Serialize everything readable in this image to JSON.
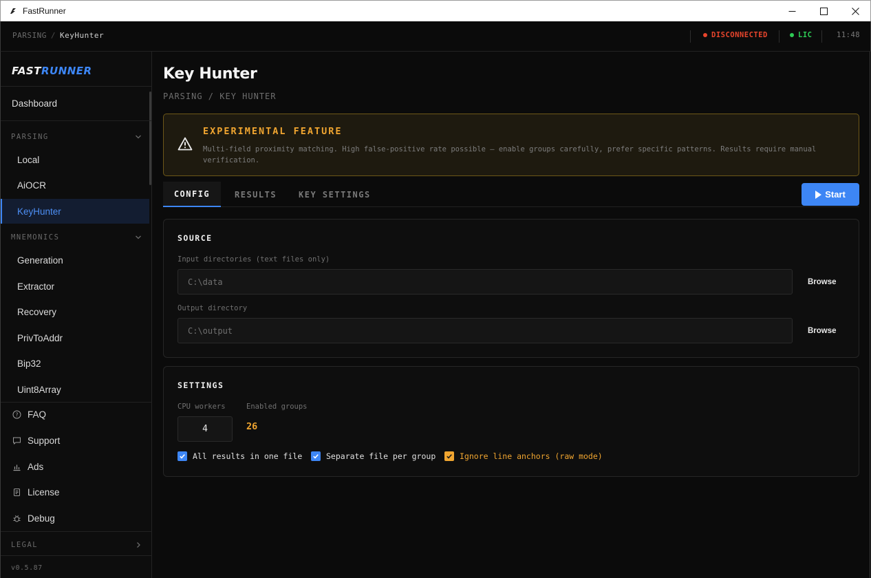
{
  "window": {
    "title": "FastRunner"
  },
  "appbar": {
    "crumb_section": "PARSING",
    "crumb_sep": "/",
    "crumb_page": "KeyHunter",
    "connection_status": "DISCONNECTED",
    "license_status": "LIC",
    "time": "11:48",
    "colors": {
      "disconnected": "#e8452c",
      "lic": "#2ecc55"
    }
  },
  "sidebar": {
    "logo_part1": "FAST",
    "logo_part2": "RUNNER",
    "dashboard": "Dashboard",
    "parsing_header": "PARSING",
    "parsing_items": [
      "Local",
      "AiOCR",
      "KeyHunter"
    ],
    "mnemonics_header": "MNEMONICS",
    "mnemonics_items": [
      "Generation",
      "Extractor",
      "Recovery",
      "PrivToAddr",
      "Bip32",
      "Uint8Array"
    ],
    "utility_items": [
      {
        "label": "FAQ",
        "icon": "help-circle-icon"
      },
      {
        "label": "Support",
        "icon": "chat-icon"
      },
      {
        "label": "Ads",
        "icon": "chart-icon"
      },
      {
        "label": "License",
        "icon": "document-icon"
      },
      {
        "label": "Debug",
        "icon": "bug-icon"
      }
    ],
    "legal_header": "LEGAL",
    "version": "v0.5.87"
  },
  "main": {
    "title": "Key Hunter",
    "breadcrumb": "PARSING / KEY HUNTER",
    "warning": {
      "title": "EXPERIMENTAL FEATURE",
      "text": "Multi-field proximity matching. High false-positive rate possible — enable groups carefully, prefer specific patterns. Results require manual verification."
    },
    "tabs": [
      "CONFIG",
      "RESULTS",
      "KEY SETTINGS"
    ],
    "start_label": "Start",
    "source": {
      "header": "SOURCE",
      "input_label": "Input directories (text files only)",
      "input_placeholder": "C:\\data",
      "output_label": "Output directory",
      "output_placeholder": "C:\\output",
      "browse_label": "Browse"
    },
    "settings": {
      "header": "SETTINGS",
      "cpu_label": "CPU workers",
      "cpu_value": "4",
      "groups_label": "Enabled groups",
      "groups_value": "26",
      "checkboxes": [
        {
          "label": "All results in one file",
          "checked": true
        },
        {
          "label": "Separate file per group",
          "checked": true
        },
        {
          "label": "Ignore line anchors (raw mode)",
          "checked": true
        }
      ]
    }
  },
  "colors": {
    "accent": "#3d86f5",
    "warning": "#f0a530"
  }
}
